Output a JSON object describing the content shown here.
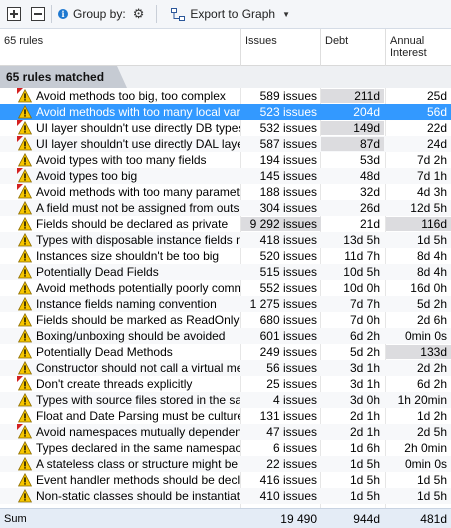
{
  "toolbar": {
    "group_by_label": "Group by:",
    "export_label": "Export to Graph"
  },
  "columns": {
    "rules": "65 rules",
    "issues": "Issues",
    "debt": "Debt",
    "annual": "Annual\nInterest"
  },
  "group": {
    "label": "65 rules matched"
  },
  "rows": [
    {
      "name": "Avoid methods too big, too complex",
      "issues": "589 issues",
      "debt": "211d",
      "annual": "25d",
      "flag": true
    },
    {
      "name": "Avoid methods with too many local variables",
      "issues": "523 issues",
      "debt": "204d",
      "annual": "56d",
      "flag": false,
      "selected": true
    },
    {
      "name": "UI layer shouldn't use directly DB types",
      "issues": "532 issues",
      "debt": "149d",
      "annual": "22d",
      "flag": true
    },
    {
      "name": "UI layer shouldn't use directly DAL layer",
      "issues": "587 issues",
      "debt": "87d",
      "annual": "24d",
      "flag": true
    },
    {
      "name": "Avoid types with too many fields",
      "issues": "194 issues",
      "debt": "53d",
      "annual": "7d  2h",
      "flag": false
    },
    {
      "name": "Avoid types too big",
      "issues": "145 issues",
      "debt": "48d",
      "annual": "7d  1h",
      "flag": true
    },
    {
      "name": "Avoid methods with too many parameters",
      "issues": "188 issues",
      "debt": "32d",
      "annual": "4d  3h",
      "flag": true
    },
    {
      "name": "A field must not be assigned from outside its parent",
      "issues": "304 issues",
      "debt": "26d",
      "annual": "12d  5h",
      "flag": false
    },
    {
      "name": "Fields should be declared as private",
      "issues": "9 292 issues",
      "debt": "21d",
      "annual": "116d",
      "flag": false
    },
    {
      "name": "Types with disposable instance fields must be disposable",
      "issues": "418 issues",
      "debt": "13d  5h",
      "annual": "1d  5h",
      "flag": false
    },
    {
      "name": "Instances size shouldn't be too big",
      "issues": "520 issues",
      "debt": "11d  7h",
      "annual": "8d  4h",
      "flag": false
    },
    {
      "name": "Potentially Dead Fields",
      "issues": "515 issues",
      "debt": "10d  5h",
      "annual": "8d  4h",
      "flag": false
    },
    {
      "name": "Avoid methods potentially poorly commented",
      "issues": "552 issues",
      "debt": "10d  0h",
      "annual": "16d  0h",
      "flag": false
    },
    {
      "name": "Instance fields naming convention",
      "issues": "1 275 issues",
      "debt": "7d  7h",
      "annual": "5d  2h",
      "flag": false
    },
    {
      "name": "Fields should be marked as ReadOnly when possible",
      "issues": "680 issues",
      "debt": "7d  0h",
      "annual": "2d  6h",
      "flag": false
    },
    {
      "name": "Boxing/unboxing should be avoided",
      "issues": "601 issues",
      "debt": "6d  2h",
      "annual": "0min  0s",
      "flag": false
    },
    {
      "name": "Potentially Dead Methods",
      "issues": "249 issues",
      "debt": "5d  2h",
      "annual": "133d",
      "flag": false
    },
    {
      "name": "Constructor should not call a virtual method",
      "issues": "56 issues",
      "debt": "3d  1h",
      "annual": "2d  2h",
      "flag": false
    },
    {
      "name": "Don't create threads explicitly",
      "issues": "25 issues",
      "debt": "3d  1h",
      "annual": "6d  2h",
      "flag": true
    },
    {
      "name": "Types with source files stored in the same directory",
      "issues": "4 issues",
      "debt": "3d  0h",
      "annual": "1h  20min",
      "flag": false
    },
    {
      "name": "Float and Date Parsing must be culture aware",
      "issues": "131 issues",
      "debt": "2d  1h",
      "annual": "1d  2h",
      "flag": false
    },
    {
      "name": "Avoid namespaces mutually dependent",
      "issues": "47 issues",
      "debt": "2d  1h",
      "annual": "2d  5h",
      "flag": true
    },
    {
      "name": "Types declared in the same namespace, should have...",
      "issues": "6 issues",
      "debt": "1d  6h",
      "annual": "2h  0min",
      "flag": false
    },
    {
      "name": "A stateless class or structure might be turned into...",
      "issues": "22 issues",
      "debt": "1d  5h",
      "annual": "0min  0s",
      "flag": false
    },
    {
      "name": "Event handler methods should be declared private",
      "issues": "416 issues",
      "debt": "1d  5h",
      "annual": "1d  5h",
      "flag": false
    },
    {
      "name": "Non-static classes should be instantiated or turned...",
      "issues": "410 issues",
      "debt": "1d  5h",
      "annual": "1d  5h",
      "flag": false
    }
  ],
  "sum": {
    "label": "Sum",
    "issues": "19 490",
    "debt": "944d",
    "annual": "481d"
  }
}
